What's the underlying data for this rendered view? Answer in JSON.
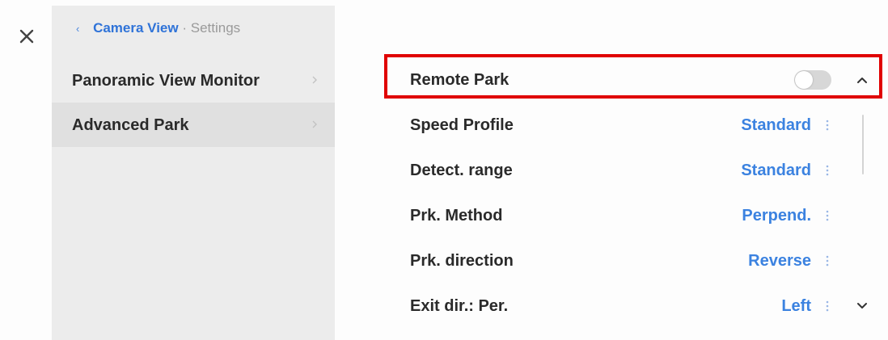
{
  "close_icon": "close-icon",
  "breadcrumb": {
    "back_icon": "chevron-left-icon",
    "link": "Camera View",
    "separator": "·",
    "current": "Settings"
  },
  "sidebar": {
    "items": [
      {
        "label": "Panoramic View Monitor",
        "active": false
      },
      {
        "label": "Advanced Park",
        "active": true
      }
    ]
  },
  "settings": {
    "remote_park": {
      "label": "Remote Park",
      "toggle_on": false
    },
    "rows": [
      {
        "label": "Speed Profile",
        "value": "Standard"
      },
      {
        "label": "Detect. range",
        "value": "Standard"
      },
      {
        "label": "Prk. Method",
        "value": "Perpend."
      },
      {
        "label": "Prk. direction",
        "value": "Reverse"
      },
      {
        "label": "Exit dir.: Per.",
        "value": "Left"
      }
    ]
  },
  "colors": {
    "accent": "#3b82e0",
    "highlight": "#e00000",
    "sidebar_bg": "#ececec",
    "sidebar_active_bg": "#e0e0e0"
  }
}
